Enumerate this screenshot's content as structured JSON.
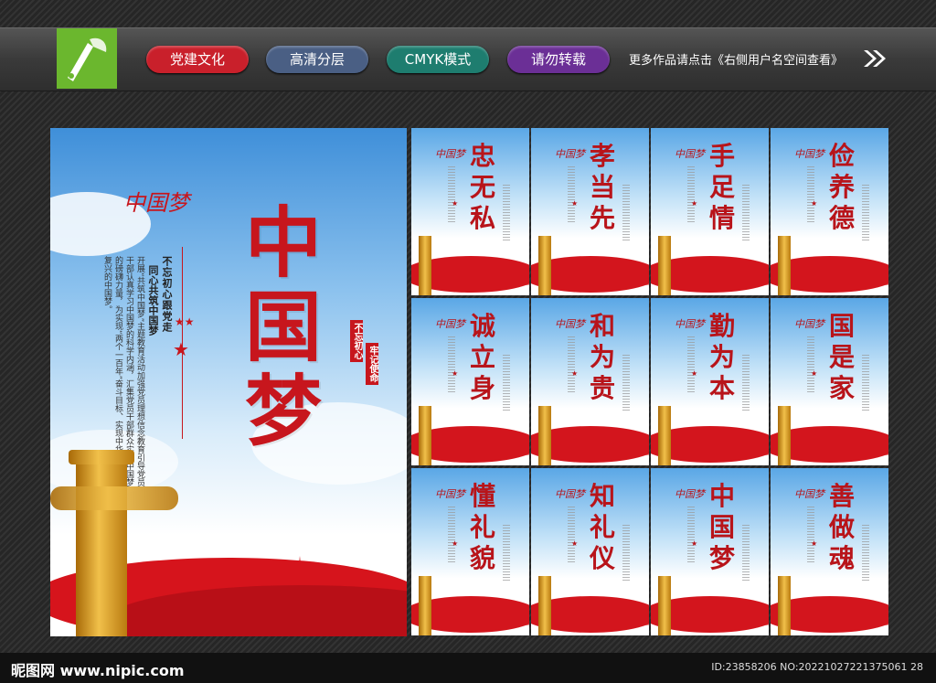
{
  "header": {
    "tags": [
      "党建文化",
      "高清分层",
      "CMYK模式",
      "请勿转载"
    ],
    "more_text": "更多作品请点击《右侧用户名空间查看》",
    "colors": {
      "tag1": "#c9202b",
      "tag2": "#4a5f84",
      "tag3": "#1e7d6f",
      "tag4": "#6b2f96",
      "logo": "#6bb72e"
    }
  },
  "main_poster": {
    "title": "中国梦",
    "slogan_1": "不忘初心跟党走",
    "slogan_2": "同心共筑中国梦",
    "body": "开展“共筑中国梦”主题教育活动加强党员理想信念教育引导党员干部认真学习中国梦的科学内涵，汇集党员干部群众实现中国梦的磅礴力量，为实现“两个一百年”奋斗目标、实现中华民族伟大复兴的中国梦。",
    "seal_1": "不忘初心",
    "seal_2": "牢记使命",
    "calligraphy": "中国梦"
  },
  "small_posters": [
    "忠无私",
    "孝当先",
    "手足情",
    "俭养德",
    "诚立身",
    "和为贵",
    "勤为本",
    "国是家",
    "懂礼貌",
    "知礼仪",
    "中国梦",
    "善做魂"
  ],
  "footer": {
    "site": "昵图网 www.nipic.com",
    "id": "ID:23858206 NO:20221027221375061 28"
  }
}
